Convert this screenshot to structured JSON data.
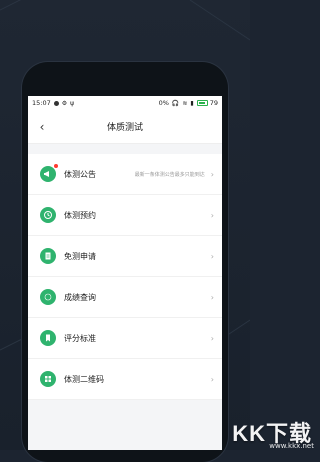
{
  "statusbar": {
    "time": "15:07",
    "net": "0%",
    "battery": "79"
  },
  "header": {
    "back_icon": "back-arrow-icon",
    "title": "体质测试"
  },
  "items": [
    {
      "label": "体测公告",
      "hint": "最新一条体测公告最多只能到达",
      "icon": "megaphone-icon",
      "badge": true
    },
    {
      "label": "体测预约",
      "hint": "",
      "icon": "clock-icon"
    },
    {
      "label": "免测申请",
      "hint": "",
      "icon": "document-icon"
    },
    {
      "label": "成绩查询",
      "hint": "",
      "icon": "circle-icon"
    },
    {
      "label": "评分标准",
      "hint": "",
      "icon": "bookmark-icon"
    },
    {
      "label": "体测二维码",
      "hint": "",
      "icon": "grid-icon"
    }
  ],
  "watermark": {
    "brand": "KK下载",
    "url": "www.kkx.net"
  },
  "colors": {
    "accent": "#2fb36e",
    "background": "#1c2430"
  }
}
